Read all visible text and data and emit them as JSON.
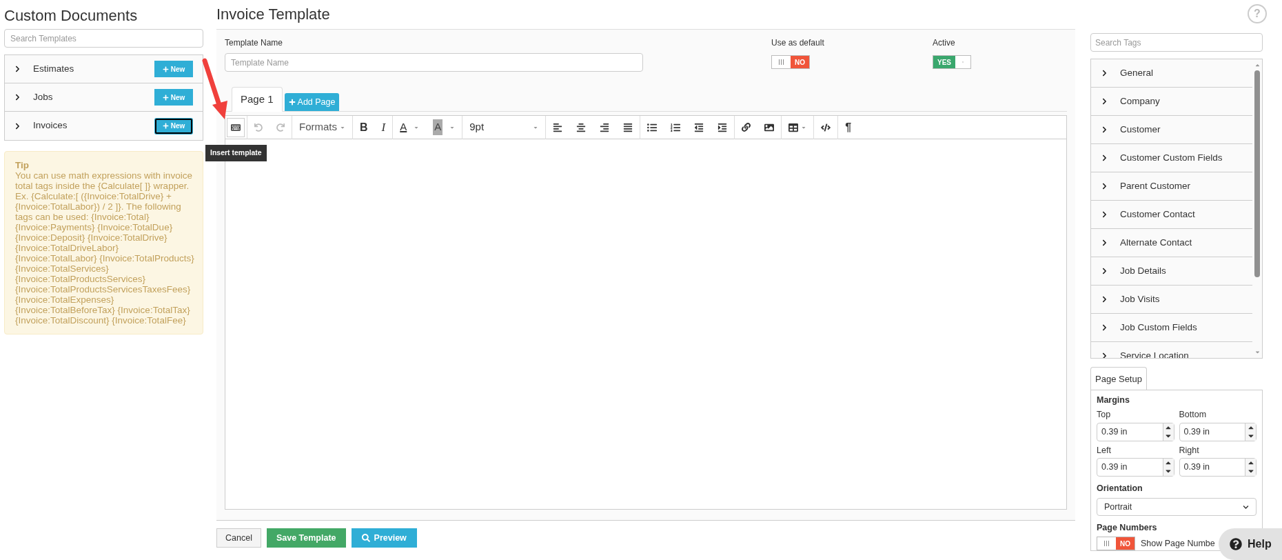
{
  "sidebar": {
    "title": "Custom Documents",
    "search": {
      "placeholder": "Search Templates"
    },
    "categories": [
      {
        "label": "Estimates",
        "button": "New",
        "focused": false
      },
      {
        "label": "Jobs",
        "button": "New",
        "focused": false
      },
      {
        "label": "Invoices",
        "button": "New",
        "focused": true
      }
    ],
    "tip": {
      "title": "Tip",
      "text": "You can use math expressions with invoice total tags inside the {Calculate[ ]} wrapper. Ex. {Calculate:[ ({Invoice:TotalDrive} + {Invoice:TotalLabor}) / 2 ]}. The following tags can be used: {Invoice:Total} {Invoice:Payments} {Invoice:TotalDue} {Invoice:Deposit} {Invoice:TotalDrive} {Invoice:TotalDriveLabor} {Invoice:TotalLabor} {Invoice:TotalProducts} {Invoice:TotalServices} {Invoice:TotalProductsServices} {Invoice:TotalProductsServicesTaxesFees} {Invoice:TotalExpenses} {Invoice:TotalBeforeTax} {Invoice:TotalTax} {Invoice:TotalDiscount} {Invoice:TotalFee}"
    }
  },
  "main": {
    "title": "Invoice Template",
    "template_name": {
      "label": "Template Name",
      "placeholder": "Template Name"
    },
    "use_as_default": {
      "label": "Use as default",
      "on": false,
      "text": "NO"
    },
    "active": {
      "label": "Active",
      "on": true,
      "text": "YES"
    },
    "tabs": [
      {
        "label": "Page 1",
        "selected": true
      }
    ],
    "add_page": "Add Page",
    "toolbar": {
      "undo_disabled": true,
      "redo_disabled": true,
      "formats": "Formats",
      "bold": "B",
      "italic": "I",
      "text_color": "A",
      "background_color": "A",
      "font_size": "9pt",
      "paragraph": "¶"
    },
    "tooltip": "Insert template",
    "buttons": {
      "cancel": "Cancel",
      "save": "Save Template",
      "preview": "Preview"
    }
  },
  "tags": {
    "search": {
      "placeholder": "Search Tags"
    },
    "items": [
      "General",
      "Company",
      "Customer",
      "Customer Custom Fields",
      "Parent Customer",
      "Customer Contact",
      "Alternate Contact",
      "Job Details",
      "Job Visits",
      "Job Custom Fields",
      "Service Location"
    ]
  },
  "page_setup": {
    "tab": "Page Setup",
    "margins_title": "Margins",
    "margins": [
      {
        "label": "Top",
        "value": "0.39 in"
      },
      {
        "label": "Bottom",
        "value": "0.39 in"
      },
      {
        "label": "Left",
        "value": "0.39 in"
      },
      {
        "label": "Right",
        "value": "0.39 in"
      }
    ],
    "orientation": {
      "label": "Orientation",
      "value": "Portrait"
    },
    "page_numbers": {
      "label": "Page Numbers",
      "on": false,
      "text": "NO",
      "caption": "Show Page Numbe"
    }
  },
  "help": "Help",
  "help_top": "?"
}
